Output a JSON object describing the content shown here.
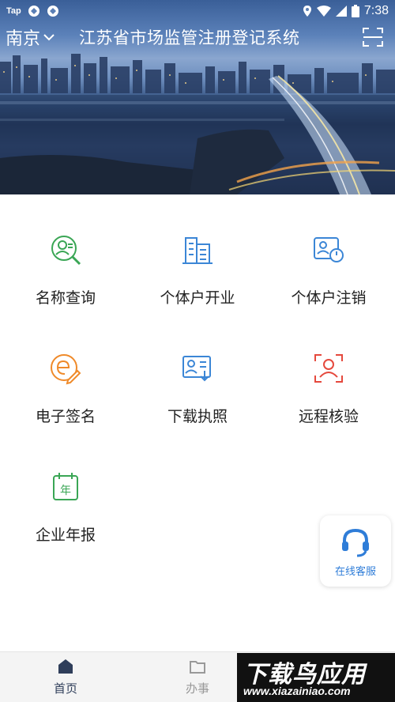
{
  "status_bar": {
    "left_label": "Tap",
    "time": "7:38"
  },
  "header": {
    "city": "南京",
    "title": "江苏省市场监管注册登记系统"
  },
  "functions": [
    {
      "label": "名称查询",
      "icon": "name-search-icon",
      "color": "#3aa655"
    },
    {
      "label": "个体户开业",
      "icon": "building-icon",
      "color": "#3b86d6"
    },
    {
      "label": "个体户注销",
      "icon": "person-power-icon",
      "color": "#3b86d6"
    },
    {
      "label": "电子签名",
      "icon": "e-sign-icon",
      "color": "#ef8a2a"
    },
    {
      "label": "下载执照",
      "icon": "download-license-icon",
      "color": "#3b86d6"
    },
    {
      "label": "远程核验",
      "icon": "face-verify-icon",
      "color": "#e5493d"
    },
    {
      "label": "企业年报",
      "icon": "annual-report-icon",
      "color": "#3aa655"
    }
  ],
  "customer_service": {
    "label": "在线客服",
    "color": "#2f7dd8"
  },
  "tabs": [
    {
      "label": "首页",
      "icon": "home-icon",
      "active": true
    },
    {
      "label": "办事",
      "icon": "folder-icon",
      "active": false
    }
  ],
  "watermark": {
    "title": "下载鸟应用",
    "url": "www.xiazainiao.com"
  }
}
